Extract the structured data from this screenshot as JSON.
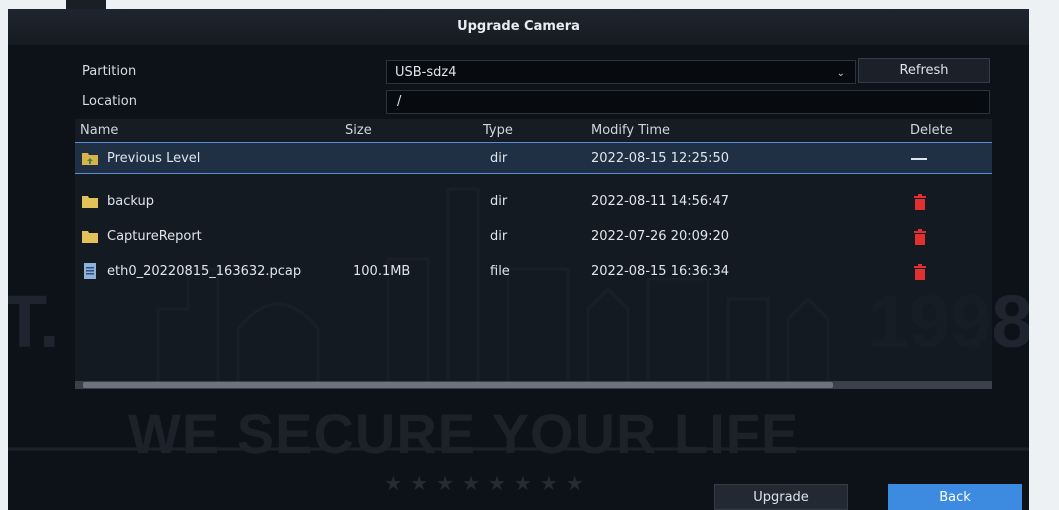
{
  "title": "Upgrade Camera",
  "partition": {
    "label": "Partition",
    "value": "USB-sdz4",
    "refresh_label": "Refresh"
  },
  "location": {
    "label": "Location",
    "value": "/"
  },
  "table": {
    "headers": {
      "name": "Name",
      "size": "Size",
      "type": "Type",
      "modify": "Modify Time",
      "delete": "Delete"
    },
    "rows": [
      {
        "name": "Previous Level",
        "size": "",
        "type": "dir",
        "modify": "2022-08-15 12:25:50",
        "icon": "folder-up-icon"
      },
      {
        "name": "backup",
        "size": "",
        "type": "dir",
        "modify": "2022-08-11 14:56:47",
        "icon": "folder-icon"
      },
      {
        "name": "CaptureReport",
        "size": "",
        "type": "dir",
        "modify": "2022-07-26 20:09:20",
        "icon": "folder-icon"
      },
      {
        "name": "eth0_20220815_163632.pcap",
        "size": "100.1MB",
        "type": "file",
        "modify": "2022-08-15 16:36:34",
        "icon": "file-icon"
      }
    ]
  },
  "buttons": {
    "upgrade": "Upgrade",
    "back": "Back"
  },
  "watermark": {
    "year": "1998",
    "slogan": "WE SECURE YOUR LIFE",
    "left": "T."
  },
  "colors": {
    "accent": "#3d8be0",
    "delete": "#e03030",
    "selection": "#1f2f44"
  }
}
